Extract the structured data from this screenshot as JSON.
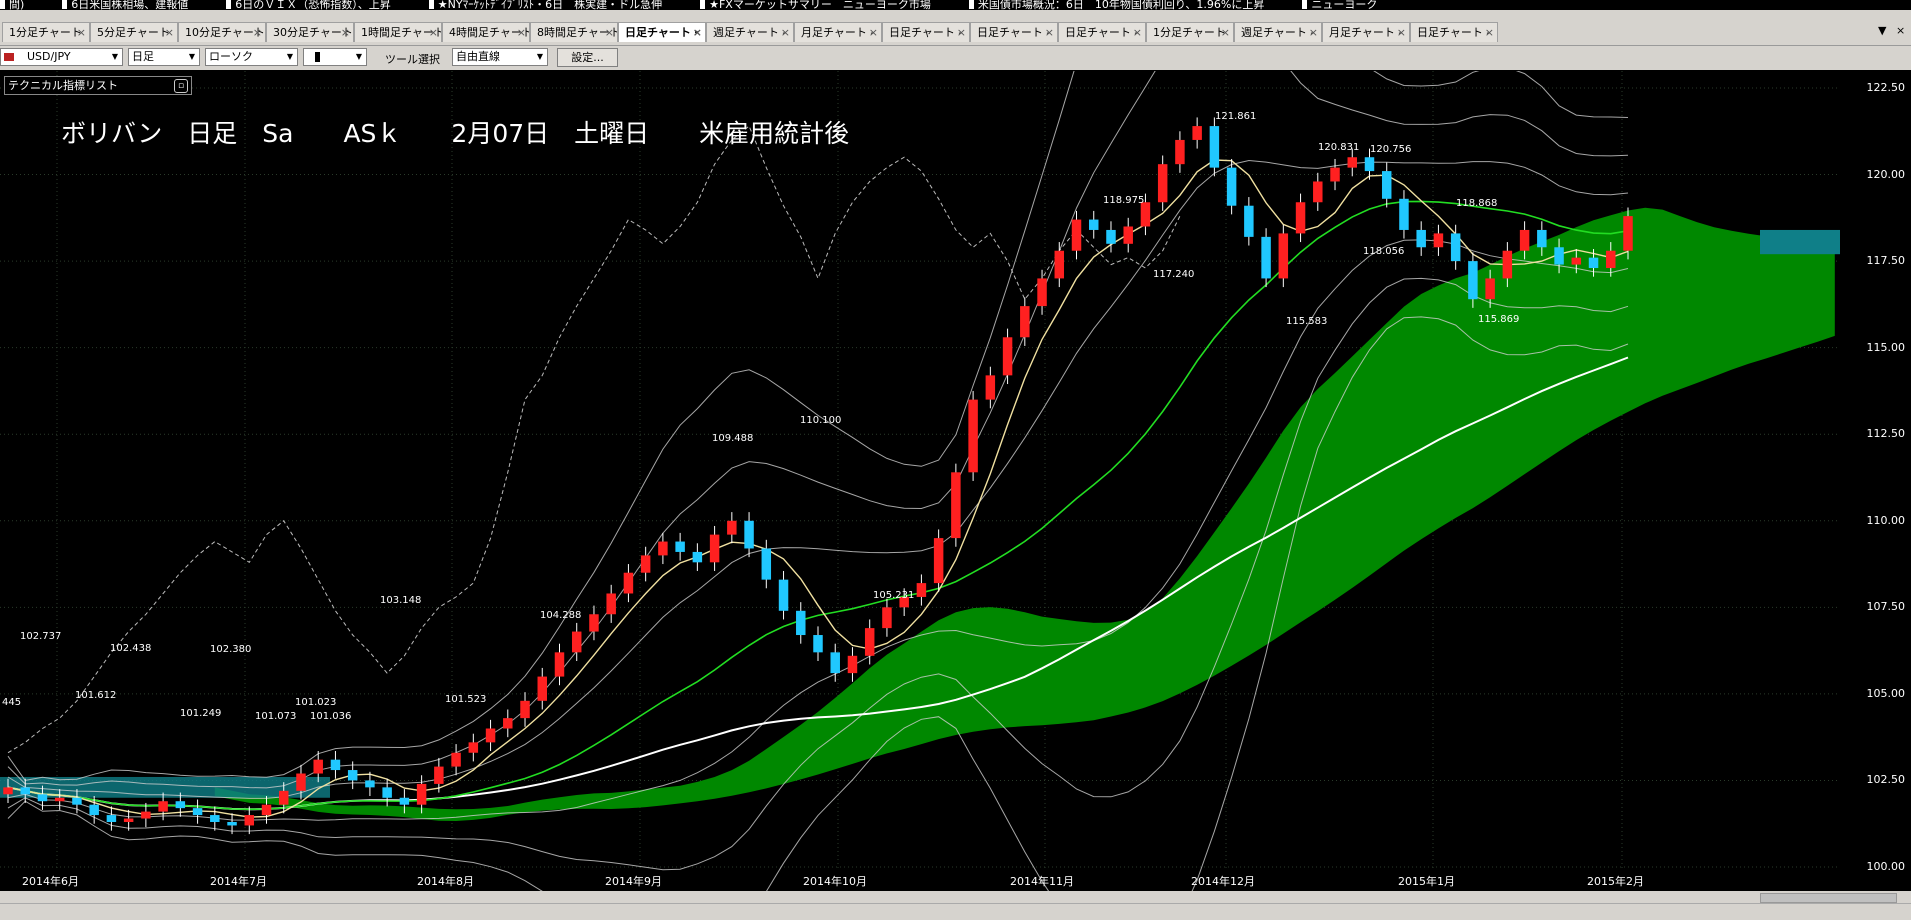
{
  "ticker": [
    "間)",
    "6日米国株相場、建報値",
    "6日のＶＩＸ（恐怖指数）、上昇",
    "★NYﾏｰｹｯﾄﾃﾞｲﾌﾞﾘｽﾄ・6日　株実建・ドル急伸",
    "★FXマーケットサマリー　ニューヨーク市場",
    "米国債市場概況：6日　10年物国債利回り、1.96%に上昇",
    "ニューヨーク"
  ],
  "tabs": [
    "1分足チャート",
    "5分足チャート",
    "10分足チャート",
    "30分足チャート",
    "1時間足チャート",
    "4時間足チャート",
    "8時間足チャート",
    "日足チャート・",
    "週足チャート -",
    "月足チャート -",
    "日足チャート -",
    "日足チャート -",
    "日足チャート -",
    "1分足チャート",
    "週足チャート -",
    "月足チャート -",
    "日足チャート -"
  ],
  "active_tab_index": 7,
  "toolbar": {
    "symbol": "USD/JPY",
    "timeframe": "日足",
    "chart_type": "ローソク",
    "tool_label": "ツール選択",
    "tool_mode": "自由直線",
    "settings_label": "設定..."
  },
  "tech_list_label": "テクニカル指標リスト",
  "caption": "ボリバン　日足　Sa　　ASｋ　　2月07日　土曜日　　米雇用統計後",
  "y_ticks": [
    "122.50",
    "120.00",
    "117.50",
    "115.00",
    "112.50",
    "110.00",
    "107.50",
    "105.00",
    "102.50",
    "100.00"
  ],
  "x_ticks": [
    "2014年6月",
    "2014年7月",
    "2014年8月",
    "2014年9月",
    "2014年10月",
    "2014年11月",
    "2014年12月",
    "2015年1月",
    "2015年2月"
  ],
  "price_labels": [
    "102.737",
    "102.438",
    "102.380",
    "101.612",
    "101.249",
    "101.073",
    "101.036",
    "101.023",
    "103.148",
    "101.523",
    "104.288",
    "109.488",
    "110.100",
    "105.231",
    "118.975",
    "117.240",
    "121.861",
    "120.831",
    "120.756",
    "118.056",
    "115.583",
    "118.868",
    "115.869",
    "445"
  ],
  "colors": {
    "bull": "#ff2020",
    "bear": "#20c8ff",
    "cloud": "#008800",
    "cloud_neg": "#0f7f88",
    "sma_fast": "#f0e0a0",
    "sma_mid": "#22dd22",
    "sma_slow": "#ffffff",
    "band": "#cfcfcf"
  },
  "chart_data": {
    "type": "candlestick",
    "title": "",
    "y_range": [
      100.0,
      123.0
    ],
    "x_months": [
      "2014年6月",
      "2014年7月",
      "2014年8月",
      "2014年9月",
      "2014年10月",
      "2014年11月",
      "2014年12月",
      "2015年1月",
      "2015年2月"
    ],
    "series": [
      {
        "name": "",
        "kind": "close",
        "values": [
          102.3,
          102.1,
          101.9,
          102.0,
          101.8,
          101.5,
          101.3,
          101.4,
          101.6,
          101.9,
          101.7,
          101.5,
          101.3,
          101.2,
          101.5,
          101.8,
          102.2,
          102.7,
          103.1,
          102.8,
          102.5,
          102.3,
          102.0,
          101.8,
          102.4,
          102.9,
          103.3,
          103.6,
          104.0,
          104.3,
          104.8,
          105.5,
          106.2,
          106.8,
          107.3,
          107.9,
          108.5,
          109.0,
          109.4,
          109.1,
          108.8,
          109.6,
          110.0,
          109.2,
          108.3,
          107.4,
          106.7,
          106.2,
          105.6,
          106.1,
          106.9,
          107.5,
          107.8,
          108.2,
          109.5,
          111.4,
          113.5,
          114.2,
          115.3,
          116.2,
          117.0,
          117.8,
          118.7,
          118.4,
          118.0,
          118.5,
          119.2,
          120.3,
          121.0,
          121.4,
          120.2,
          119.1,
          118.2,
          117.0,
          118.3,
          119.2,
          119.8,
          120.2,
          120.5,
          120.1,
          119.3,
          118.4,
          117.9,
          118.3,
          117.5,
          116.4,
          117.0,
          117.8,
          118.4,
          117.9,
          117.4,
          117.6,
          117.3,
          117.8,
          118.8
        ]
      },
      {
        "name": "",
        "kind": "ichimoku_cloud"
      },
      {
        "name": "",
        "kind": "bollinger_bands"
      },
      {
        "name": "",
        "kind": "moving_averages"
      }
    ]
  }
}
